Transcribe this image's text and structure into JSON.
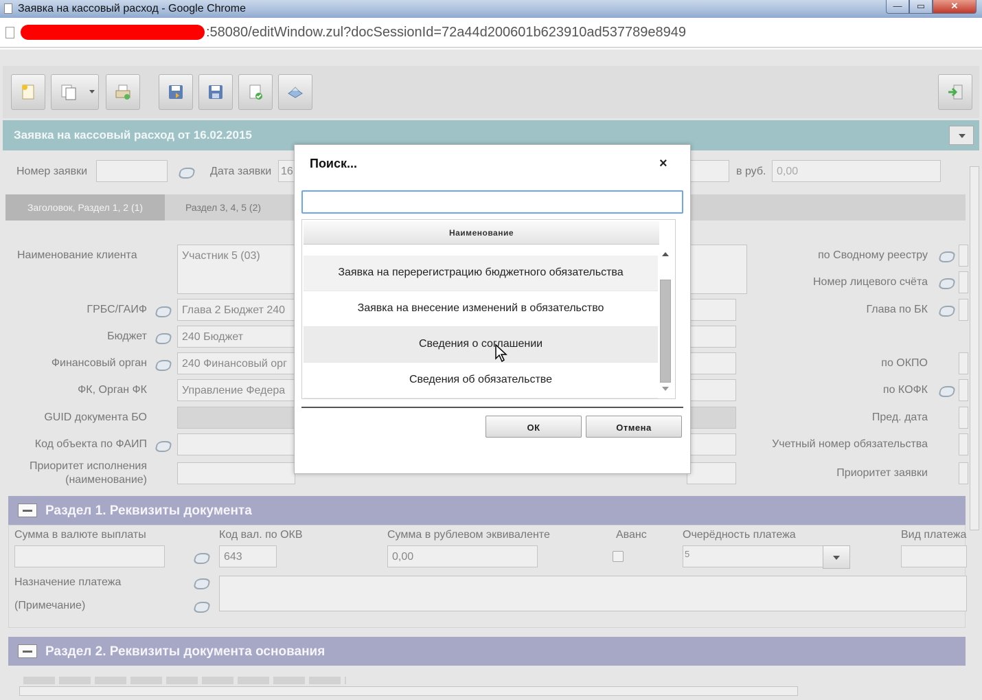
{
  "window": {
    "title": "Заявка на кассовый расход - Google Chrome",
    "url": ":58080/editWindow.zul?docSessionId=72a44d200601b623910ad537789e8949"
  },
  "doc": {
    "header": "Заявка на кассовый расход от 16.02.2015",
    "number_label": "Номер заявки",
    "date_label": "Дата заявки",
    "date_value": "16.",
    "rub_label": "в руб.",
    "rub_value": "0,00"
  },
  "tabs": [
    {
      "label": "Заголовок, Раздел 1, 2 (1)"
    },
    {
      "label": "Раздел 3, 4, 5 (2)"
    }
  ],
  "form_left": {
    "client_label": "Наименование клиента",
    "client_value": "Участник 5 (03)",
    "grbs_label": "ГРБС/ГАИФ",
    "grbs_value": "Глава 2 Бюджет 240",
    "budget_label": "Бюджет",
    "budget_value": "240 Бюджет",
    "fin_label": "Финансовый орган",
    "fin_value": "240 Финансовый орг",
    "fk_label": "ФК, Орган ФК",
    "fk_value": "Управление Федера",
    "guid_label": "GUID документа БО",
    "faip_label": "Код объекта по ФАИП",
    "priority_label_1": "Приоритет исполнения",
    "priority_label_2": "(наименование)"
  },
  "form_right": {
    "summary_label": "по Сводному реестру",
    "account_label": "Номер лицевого счёта",
    "chapter_label": "Глава по БК",
    "okpo_label": "по ОКПО",
    "kofk_label": "по КОФК",
    "prev_date_label": "Пред. дата",
    "obligation_label": "Учетный номер обязательства",
    "request_priority_label": "Приоритет заявки"
  },
  "section1": {
    "title": "Раздел 1. Реквизиты документа",
    "sum_currency_label": "Сумма в валюте выплаты",
    "currency_code_label": "Код вал. по ОКВ",
    "currency_code_value": "643",
    "sum_rub_label": "Сумма в рублевом эквиваленте",
    "sum_rub_value": "0,00",
    "advance_label": "Аванс",
    "order_label": "Очерёдность платежа",
    "order_value": "5",
    "payment_type_label": "Вид платежа",
    "purpose_label": "Назначение платежа",
    "note_label": "(Примечание)"
  },
  "section2": {
    "title": "Раздел 2. Реквизиты документа основания"
  },
  "dialog": {
    "title": "Поиск...",
    "close": "×",
    "search_value": "",
    "column_header": "Наименование",
    "rows": [
      "Заявка на перерегистрацию бюджетного обязательства",
      "Заявка на внесение изменений в обязательство",
      "Сведения о соглашении",
      "Сведения об обязательстве"
    ],
    "ok_label": "ОК",
    "cancel_label": "Отмена"
  }
}
